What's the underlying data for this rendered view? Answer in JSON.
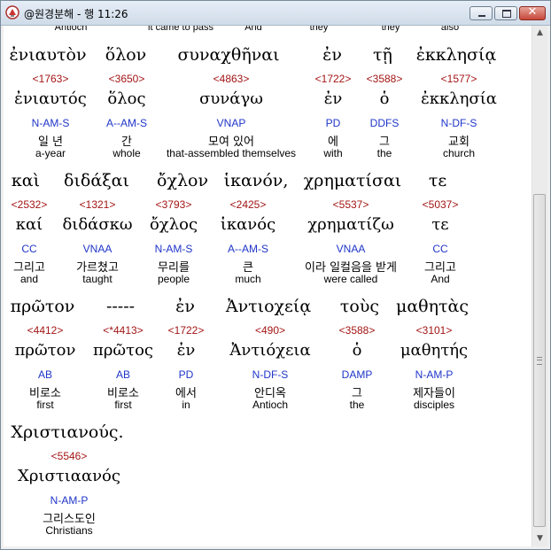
{
  "window": {
    "title": "@원경분해 - 행 11:26"
  },
  "top_english": [
    "Antioch",
    "it came to pass",
    "And",
    "they",
    "they",
    "also"
  ],
  "lines": [
    {
      "greek_text": [
        "ἐνιαυτὸν",
        "ὅλον",
        "συναχθῆναι",
        "ἐν",
        "τῇ",
        "ἐκκλησίᾳ"
      ],
      "words": [
        {
          "strong": "<1763>",
          "lemma": "ἐνιαυτός",
          "parse": "N-AM-S",
          "korean": "일 년",
          "english": "a-year"
        },
        {
          "strong": "<3650>",
          "lemma": "ὅλος",
          "parse": "A--AM-S",
          "korean": "간",
          "english": "whole"
        },
        {
          "strong": "<4863>",
          "lemma": "συνάγω",
          "parse": "VNAP",
          "korean": "모여 있어",
          "english": "that-assembled themselves"
        },
        {
          "strong": "<1722>",
          "lemma": "ἐν",
          "parse": "PD",
          "korean": "에",
          "english": "with"
        },
        {
          "strong": "<3588>",
          "lemma": "ὁ",
          "parse": "DDFS",
          "korean": "그",
          "english": "the"
        },
        {
          "strong": "<1577>",
          "lemma": "ἐκκλησία",
          "parse": "N-DF-S",
          "korean": "교회",
          "english": "church"
        }
      ]
    },
    {
      "greek_text": [
        "καὶ",
        "διδάξαι",
        "ὄχλον",
        "ἱκανόν,",
        "χρηματίσαι",
        "τε"
      ],
      "words": [
        {
          "strong": "<2532>",
          "lemma": "καί",
          "parse": "CC",
          "korean": "그리고",
          "english": "and"
        },
        {
          "strong": "<1321>",
          "lemma": "διδάσκω",
          "parse": "VNAA",
          "korean": "가르쳤고",
          "english": "taught"
        },
        {
          "strong": "<3793>",
          "lemma": "ὄχλος",
          "parse": "N-AM-S",
          "korean": "무리를",
          "english": "people"
        },
        {
          "strong": "<2425>",
          "lemma": "ἱκανός",
          "parse": "A--AM-S",
          "korean": "큰",
          "english": "much"
        },
        {
          "strong": "<5537>",
          "lemma": "χρηματίζω",
          "parse": "VNAA",
          "korean": "이라 일컬음을 받게",
          "english": "were called"
        },
        {
          "strong": "<5037>",
          "lemma": "τε",
          "parse": "CC",
          "korean": "그리고",
          "english": "And"
        }
      ]
    },
    {
      "greek_text": [
        "πρῶτον",
        "-----",
        "ἐν",
        "Ἀντιοχείᾳ",
        "τοὺς",
        "μαθητὰς"
      ],
      "words": [
        {
          "strong": "<4412>",
          "lemma": "πρῶτον",
          "parse": "AB",
          "korean": "비로소",
          "english": "first"
        },
        {
          "strong": "<*4413>",
          "lemma": "πρῶτος",
          "parse": "AB",
          "korean": "비로소",
          "english": "first"
        },
        {
          "strong": "<1722>",
          "lemma": "ἐν",
          "parse": "PD",
          "korean": "에서",
          "english": "in"
        },
        {
          "strong": "<490>",
          "lemma": "Ἀντιόχεια",
          "parse": "N-DF-S",
          "korean": "안디옥",
          "english": "Antioch"
        },
        {
          "strong": "<3588>",
          "lemma": "ὁ",
          "parse": "DAMP",
          "korean": "그",
          "english": "the"
        },
        {
          "strong": "<3101>",
          "lemma": "μαθητής",
          "parse": "N-AM-P",
          "korean": "제자들이",
          "english": "disciples"
        }
      ]
    },
    {
      "greek_text": [
        "Χριστιανούς."
      ],
      "words": [
        {
          "strong": "<5546>",
          "lemma": "Χριστιαανός",
          "parse": "N-AM-P",
          "korean": "그리스도인",
          "english": "Christians"
        }
      ]
    }
  ]
}
